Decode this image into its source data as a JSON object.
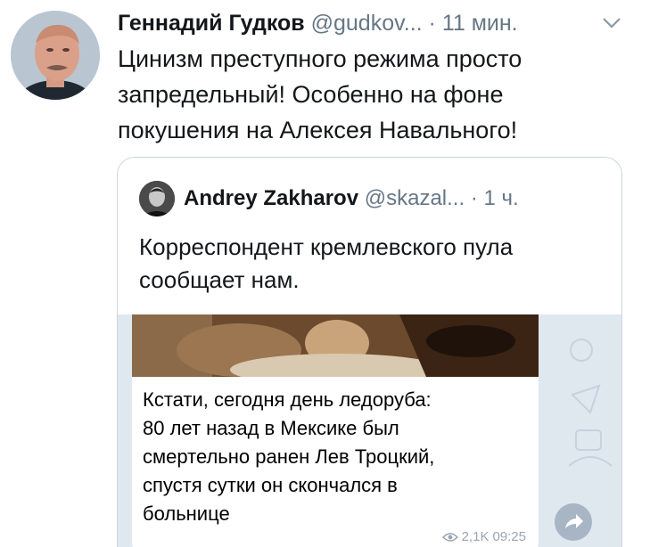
{
  "tweet": {
    "author": "Геннадий Гудков",
    "handle": "@gudkov...",
    "separator": "·",
    "time": "11 мин.",
    "text": "Цинизм преступного режима просто запредельный! Особенно на фоне покушения на Алексея Навального!",
    "menu_icon": "chevron-down-icon"
  },
  "quote": {
    "author": "Andrey Zakharov",
    "handle": "@skazal...",
    "separator": "·",
    "time": "1 ч.",
    "text": "Корреспондент кремлевского пула сообщает нам.",
    "media": {
      "message_lines": [
        "Кстати, сегодня день ледоруба:",
        "80 лет назад в Мексике был",
        "смертельно ранен Лев Троцкий,",
        "спустя сутки он скончался в",
        "больнице"
      ],
      "views": "2,1K",
      "time": "09:25",
      "views_icon": "eye-icon",
      "share_icon": "share-arrow-icon"
    }
  },
  "colors": {
    "text": "#14171a",
    "secondary": "#657786",
    "border": "#ccd6dd",
    "chat_bg": "#dfe7ef"
  }
}
